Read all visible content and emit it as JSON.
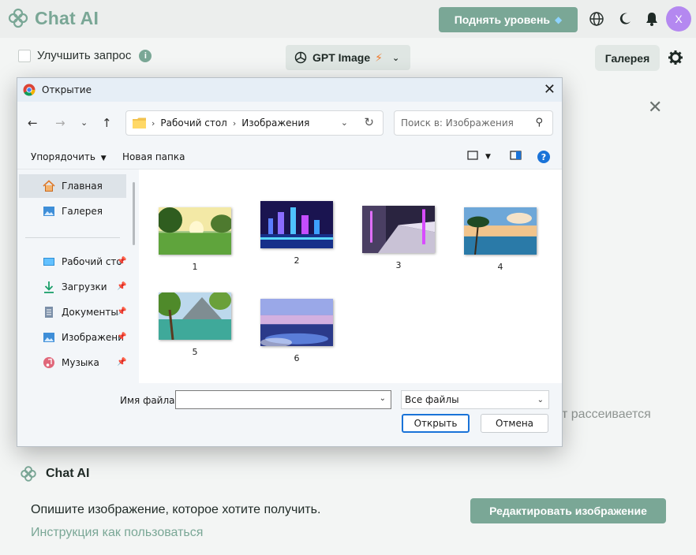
{
  "app": {
    "brand": "Chat AI",
    "upgrade_label": "Поднять уровень",
    "avatar_letter": "X",
    "accent": "#7aa796"
  },
  "controls": {
    "improve_label": "Улучшить запрос",
    "model_label": "GPT Image",
    "gallery_label": "Галерея"
  },
  "background_text": "т рассеивается",
  "card": {
    "brand": "Chat AI",
    "prompt": "Опишите изображение, которое хотите получить.",
    "help_link": "Инструкция как пользоваться",
    "edit_button": "Редактировать изображение"
  },
  "dialog": {
    "title": "Открытие",
    "path": [
      "Рабочий стол",
      "Изображения"
    ],
    "search_placeholder": "Поиск в: Изображения",
    "organize_label": "Упорядочить",
    "new_folder_label": "Новая папка",
    "sidebar": [
      {
        "label": "Главная",
        "icon": "home-icon",
        "pinned": false,
        "selected": true
      },
      {
        "label": "Галерея",
        "icon": "gallery-icon",
        "pinned": false,
        "selected": false
      },
      {
        "label": "Рабочий сто",
        "icon": "desktop-icon",
        "pinned": true,
        "selected": false
      },
      {
        "label": "Загрузки",
        "icon": "download-icon",
        "pinned": true,
        "selected": false
      },
      {
        "label": "Документы",
        "icon": "documents-icon",
        "pinned": true,
        "selected": false
      },
      {
        "label": "Изображени",
        "icon": "pictures-icon",
        "pinned": true,
        "selected": false
      },
      {
        "label": "Музыка",
        "icon": "music-icon",
        "pinned": true,
        "selected": false
      }
    ],
    "files": [
      {
        "name": "1",
        "scene": "green-meadow-sunset"
      },
      {
        "name": "2",
        "scene": "night-city-skyline"
      },
      {
        "name": "3",
        "scene": "neon-train-station"
      },
      {
        "name": "4",
        "scene": "tropical-beach-palms"
      },
      {
        "name": "5",
        "scene": "mountain-lake"
      },
      {
        "name": "6",
        "scene": "ocean-twilight"
      }
    ],
    "filename_label": "Имя файла:",
    "filename_value": "",
    "filter_value": "Все файлы",
    "open_button": "Открыть",
    "cancel_button": "Отмена"
  }
}
